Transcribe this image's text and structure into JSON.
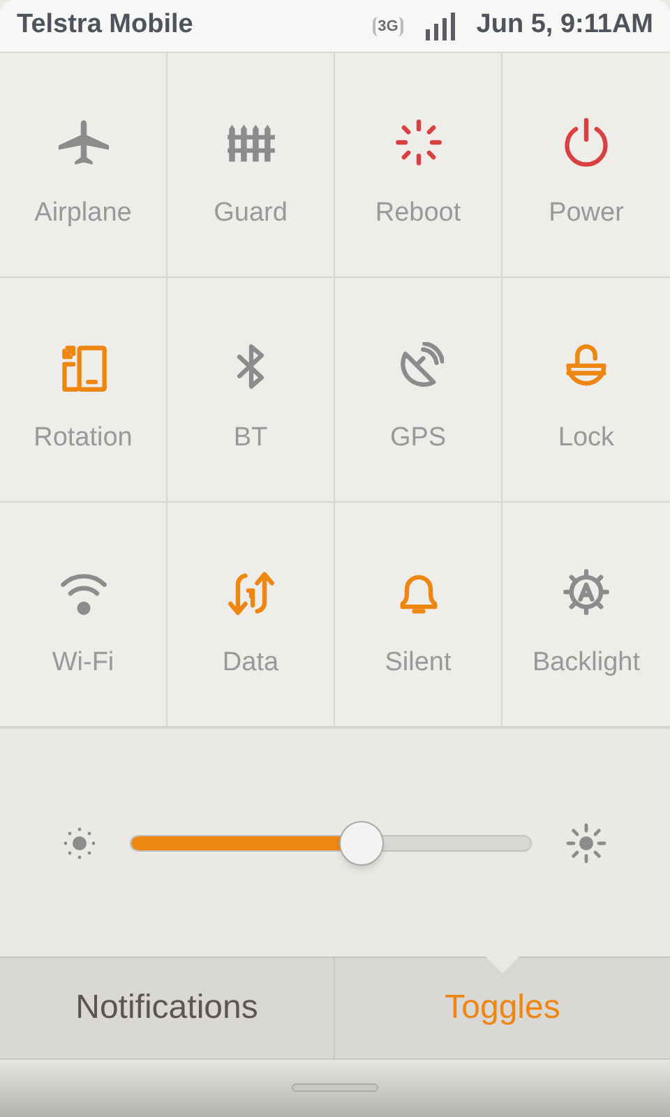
{
  "status_bar": {
    "carrier": "Telstra Mobile",
    "network": "3G",
    "datetime": "Jun 5, 9:11AM"
  },
  "toggles": [
    {
      "label": "Airplane",
      "kind": "airplane",
      "color": "#8c8c8c"
    },
    {
      "label": "Guard",
      "kind": "fence",
      "color": "#8c8c8c"
    },
    {
      "label": "Reboot",
      "kind": "spinner",
      "color": "#d9403f"
    },
    {
      "label": "Power",
      "kind": "power",
      "color": "#d9403f"
    },
    {
      "label": "Rotation",
      "kind": "rotation",
      "color": "#ee8612"
    },
    {
      "label": "BT",
      "kind": "bluetooth",
      "color": "#8c8c8c"
    },
    {
      "label": "GPS",
      "kind": "satellite",
      "color": "#8c8c8c"
    },
    {
      "label": "Lock",
      "kind": "lock",
      "color": "#ee8612"
    },
    {
      "label": "Wi-Fi",
      "kind": "wifi",
      "color": "#8c8c8c"
    },
    {
      "label": "Data",
      "kind": "data",
      "color": "#ee8612"
    },
    {
      "label": "Silent",
      "kind": "bell",
      "color": "#ee8612"
    },
    {
      "label": "Backlight",
      "kind": "backlight",
      "color": "#8c8c8c"
    }
  ],
  "brightness": {
    "level": 0.575
  },
  "tabs": [
    {
      "label": "Notifications",
      "selected": false
    },
    {
      "label": "Toggles",
      "selected": true
    }
  ]
}
